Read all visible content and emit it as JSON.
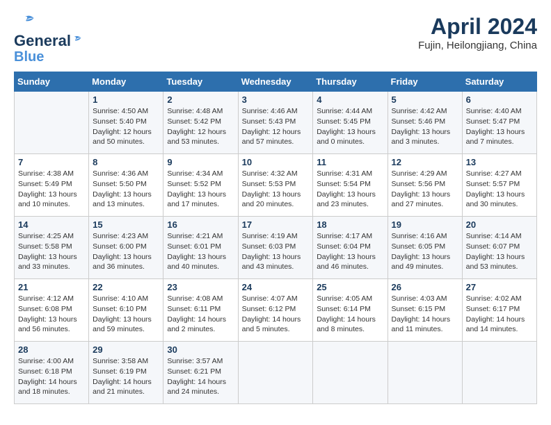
{
  "logo": {
    "line1": "General",
    "line2": "Blue"
  },
  "title": "April 2024",
  "subtitle": "Fujin, Heilongjiang, China",
  "weekdays": [
    "Sunday",
    "Monday",
    "Tuesday",
    "Wednesday",
    "Thursday",
    "Friday",
    "Saturday"
  ],
  "weeks": [
    [
      {
        "day": "",
        "info": ""
      },
      {
        "day": "1",
        "info": "Sunrise: 4:50 AM\nSunset: 5:40 PM\nDaylight: 12 hours\nand 50 minutes."
      },
      {
        "day": "2",
        "info": "Sunrise: 4:48 AM\nSunset: 5:42 PM\nDaylight: 12 hours\nand 53 minutes."
      },
      {
        "day": "3",
        "info": "Sunrise: 4:46 AM\nSunset: 5:43 PM\nDaylight: 12 hours\nand 57 minutes."
      },
      {
        "day": "4",
        "info": "Sunrise: 4:44 AM\nSunset: 5:45 PM\nDaylight: 13 hours\nand 0 minutes."
      },
      {
        "day": "5",
        "info": "Sunrise: 4:42 AM\nSunset: 5:46 PM\nDaylight: 13 hours\nand 3 minutes."
      },
      {
        "day": "6",
        "info": "Sunrise: 4:40 AM\nSunset: 5:47 PM\nDaylight: 13 hours\nand 7 minutes."
      }
    ],
    [
      {
        "day": "7",
        "info": "Sunrise: 4:38 AM\nSunset: 5:49 PM\nDaylight: 13 hours\nand 10 minutes."
      },
      {
        "day": "8",
        "info": "Sunrise: 4:36 AM\nSunset: 5:50 PM\nDaylight: 13 hours\nand 13 minutes."
      },
      {
        "day": "9",
        "info": "Sunrise: 4:34 AM\nSunset: 5:52 PM\nDaylight: 13 hours\nand 17 minutes."
      },
      {
        "day": "10",
        "info": "Sunrise: 4:32 AM\nSunset: 5:53 PM\nDaylight: 13 hours\nand 20 minutes."
      },
      {
        "day": "11",
        "info": "Sunrise: 4:31 AM\nSunset: 5:54 PM\nDaylight: 13 hours\nand 23 minutes."
      },
      {
        "day": "12",
        "info": "Sunrise: 4:29 AM\nSunset: 5:56 PM\nDaylight: 13 hours\nand 27 minutes."
      },
      {
        "day": "13",
        "info": "Sunrise: 4:27 AM\nSunset: 5:57 PM\nDaylight: 13 hours\nand 30 minutes."
      }
    ],
    [
      {
        "day": "14",
        "info": "Sunrise: 4:25 AM\nSunset: 5:58 PM\nDaylight: 13 hours\nand 33 minutes."
      },
      {
        "day": "15",
        "info": "Sunrise: 4:23 AM\nSunset: 6:00 PM\nDaylight: 13 hours\nand 36 minutes."
      },
      {
        "day": "16",
        "info": "Sunrise: 4:21 AM\nSunset: 6:01 PM\nDaylight: 13 hours\nand 40 minutes."
      },
      {
        "day": "17",
        "info": "Sunrise: 4:19 AM\nSunset: 6:03 PM\nDaylight: 13 hours\nand 43 minutes."
      },
      {
        "day": "18",
        "info": "Sunrise: 4:17 AM\nSunset: 6:04 PM\nDaylight: 13 hours\nand 46 minutes."
      },
      {
        "day": "19",
        "info": "Sunrise: 4:16 AM\nSunset: 6:05 PM\nDaylight: 13 hours\nand 49 minutes."
      },
      {
        "day": "20",
        "info": "Sunrise: 4:14 AM\nSunset: 6:07 PM\nDaylight: 13 hours\nand 53 minutes."
      }
    ],
    [
      {
        "day": "21",
        "info": "Sunrise: 4:12 AM\nSunset: 6:08 PM\nDaylight: 13 hours\nand 56 minutes."
      },
      {
        "day": "22",
        "info": "Sunrise: 4:10 AM\nSunset: 6:10 PM\nDaylight: 13 hours\nand 59 minutes."
      },
      {
        "day": "23",
        "info": "Sunrise: 4:08 AM\nSunset: 6:11 PM\nDaylight: 14 hours\nand 2 minutes."
      },
      {
        "day": "24",
        "info": "Sunrise: 4:07 AM\nSunset: 6:12 PM\nDaylight: 14 hours\nand 5 minutes."
      },
      {
        "day": "25",
        "info": "Sunrise: 4:05 AM\nSunset: 6:14 PM\nDaylight: 14 hours\nand 8 minutes."
      },
      {
        "day": "26",
        "info": "Sunrise: 4:03 AM\nSunset: 6:15 PM\nDaylight: 14 hours\nand 11 minutes."
      },
      {
        "day": "27",
        "info": "Sunrise: 4:02 AM\nSunset: 6:17 PM\nDaylight: 14 hours\nand 14 minutes."
      }
    ],
    [
      {
        "day": "28",
        "info": "Sunrise: 4:00 AM\nSunset: 6:18 PM\nDaylight: 14 hours\nand 18 minutes."
      },
      {
        "day": "29",
        "info": "Sunrise: 3:58 AM\nSunset: 6:19 PM\nDaylight: 14 hours\nand 21 minutes."
      },
      {
        "day": "30",
        "info": "Sunrise: 3:57 AM\nSunset: 6:21 PM\nDaylight: 14 hours\nand 24 minutes."
      },
      {
        "day": "",
        "info": ""
      },
      {
        "day": "",
        "info": ""
      },
      {
        "day": "",
        "info": ""
      },
      {
        "day": "",
        "info": ""
      }
    ]
  ]
}
